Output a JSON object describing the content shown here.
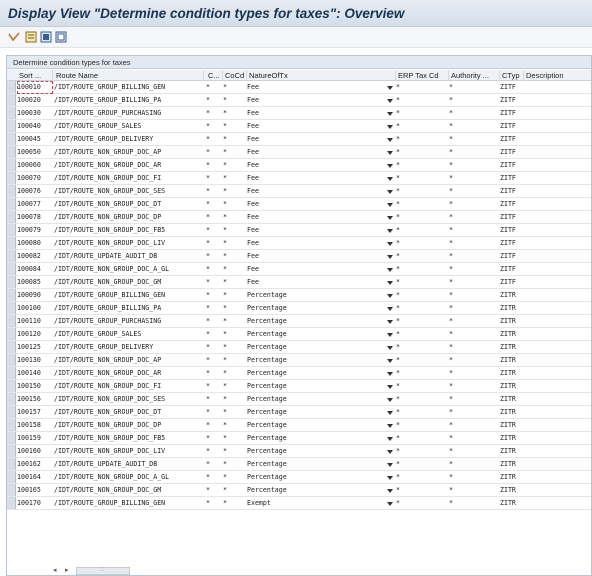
{
  "window": {
    "title": "Display View \"Determine condition types for taxes\": Overview"
  },
  "toolbar": {
    "icons": [
      "glasses-icon",
      "details-icon",
      "select-all-icon",
      "deselect-all-icon"
    ]
  },
  "table": {
    "title": "Determine condition types for taxes",
    "headers": {
      "sort": "Sort ...",
      "route": "Route Name",
      "c": "C...",
      "cocd": "CoCd",
      "nature": "NatureOfTx",
      "erp": "ERP Tax Cd",
      "authority": "Authority ...",
      "ctyp": "CTyp",
      "description": "Description"
    },
    "rows": [
      {
        "sort": "100010",
        "route": "/IDT/ROUTE_GROUP_BILLING_GEN",
        "c": "*",
        "cocd": "*",
        "nature": "Fee",
        "erp": "*",
        "authority": "*",
        "ctyp": "ZITF"
      },
      {
        "sort": "100020",
        "route": "/IDT/ROUTE_GROUP_BILLING_PA",
        "c": "*",
        "cocd": "*",
        "nature": "Fee",
        "erp": "*",
        "authority": "*",
        "ctyp": "ZITF"
      },
      {
        "sort": "100030",
        "route": "/IDT/ROUTE_GROUP_PURCHASING",
        "c": "*",
        "cocd": "*",
        "nature": "Fee",
        "erp": "*",
        "authority": "*",
        "ctyp": "ZITF"
      },
      {
        "sort": "100040",
        "route": "/IDT/ROUTE_GROUP_SALES",
        "c": "*",
        "cocd": "*",
        "nature": "Fee",
        "erp": "*",
        "authority": "*",
        "ctyp": "ZITF"
      },
      {
        "sort": "100045",
        "route": "/IDT/ROUTE_GROUP_DELIVERY",
        "c": "*",
        "cocd": "*",
        "nature": "Fee",
        "erp": "*",
        "authority": "*",
        "ctyp": "ZITF"
      },
      {
        "sort": "100050",
        "route": "/IDT/ROUTE_NON_GROUP_DOC_AP",
        "c": "*",
        "cocd": "*",
        "nature": "Fee",
        "erp": "*",
        "authority": "*",
        "ctyp": "ZITF"
      },
      {
        "sort": "100060",
        "route": "/IDT/ROUTE_NON_GROUP_DOC_AR",
        "c": "*",
        "cocd": "*",
        "nature": "Fee",
        "erp": "*",
        "authority": "*",
        "ctyp": "ZITF"
      },
      {
        "sort": "100070",
        "route": "/IDT/ROUTE_NON_GROUP_DOC_FI",
        "c": "*",
        "cocd": "*",
        "nature": "Fee",
        "erp": "*",
        "authority": "*",
        "ctyp": "ZITF"
      },
      {
        "sort": "100076",
        "route": "/IDT/ROUTE_NON_GROUP_DOC_SES",
        "c": "*",
        "cocd": "*",
        "nature": "Fee",
        "erp": "*",
        "authority": "*",
        "ctyp": "ZITF"
      },
      {
        "sort": "100077",
        "route": "/IDT/ROUTE_NON_GROUP_DOC_DT",
        "c": "*",
        "cocd": "*",
        "nature": "Fee",
        "erp": "*",
        "authority": "*",
        "ctyp": "ZITF"
      },
      {
        "sort": "100078",
        "route": "/IDT/ROUTE_NON_GROUP_DOC_DP",
        "c": "*",
        "cocd": "*",
        "nature": "Fee",
        "erp": "*",
        "authority": "*",
        "ctyp": "ZITF"
      },
      {
        "sort": "100079",
        "route": "/IDT/ROUTE_NON_GROUP_DOC_FB5",
        "c": "*",
        "cocd": "*",
        "nature": "Fee",
        "erp": "*",
        "authority": "*",
        "ctyp": "ZITF"
      },
      {
        "sort": "100080",
        "route": "/IDT/ROUTE_NON_GROUP_DOC_LIV",
        "c": "*",
        "cocd": "*",
        "nature": "Fee",
        "erp": "*",
        "authority": "*",
        "ctyp": "ZITF"
      },
      {
        "sort": "100082",
        "route": "/IDT/ROUTE_UPDATE_AUDIT_DB",
        "c": "*",
        "cocd": "*",
        "nature": "Fee",
        "erp": "*",
        "authority": "*",
        "ctyp": "ZITF"
      },
      {
        "sort": "100084",
        "route": "/IDT/ROUTE_NON_GROUP_DOC_A_GL",
        "c": "*",
        "cocd": "*",
        "nature": "Fee",
        "erp": "*",
        "authority": "*",
        "ctyp": "ZITF"
      },
      {
        "sort": "100085",
        "route": "/IDT/ROUTE_NON_GROUP_DOC_GM",
        "c": "*",
        "cocd": "*",
        "nature": "Fee",
        "erp": "*",
        "authority": "*",
        "ctyp": "ZITF"
      },
      {
        "sort": "100090",
        "route": "/IDT/ROUTE_GROUP_BILLING_GEN",
        "c": "*",
        "cocd": "*",
        "nature": "Percentage",
        "erp": "*",
        "authority": "*",
        "ctyp": "ZITR"
      },
      {
        "sort": "100100",
        "route": "/IDT/ROUTE_GROUP_BILLING_PA",
        "c": "*",
        "cocd": "*",
        "nature": "Percentage",
        "erp": "*",
        "authority": "*",
        "ctyp": "ZITR"
      },
      {
        "sort": "100110",
        "route": "/IDT/ROUTE_GROUP_PURCHASING",
        "c": "*",
        "cocd": "*",
        "nature": "Percentage",
        "erp": "*",
        "authority": "*",
        "ctyp": "ZITR"
      },
      {
        "sort": "100120",
        "route": "/IDT/ROUTE_GROUP_SALES",
        "c": "*",
        "cocd": "*",
        "nature": "Percentage",
        "erp": "*",
        "authority": "*",
        "ctyp": "ZITR"
      },
      {
        "sort": "100125",
        "route": "/IDT/ROUTE_GROUP_DELIVERY",
        "c": "*",
        "cocd": "*",
        "nature": "Percentage",
        "erp": "*",
        "authority": "*",
        "ctyp": "ZITR"
      },
      {
        "sort": "100130",
        "route": "/IDT/ROUTE_NON_GROUP_DOC_AP",
        "c": "*",
        "cocd": "*",
        "nature": "Percentage",
        "erp": "*",
        "authority": "*",
        "ctyp": "ZITR"
      },
      {
        "sort": "100140",
        "route": "/IDT/ROUTE_NON_GROUP_DOC_AR",
        "c": "*",
        "cocd": "*",
        "nature": "Percentage",
        "erp": "*",
        "authority": "*",
        "ctyp": "ZITR"
      },
      {
        "sort": "100150",
        "route": "/IDT/ROUTE_NON_GROUP_DOC_FI",
        "c": "*",
        "cocd": "*",
        "nature": "Percentage",
        "erp": "*",
        "authority": "*",
        "ctyp": "ZITR"
      },
      {
        "sort": "100156",
        "route": "/IDT/ROUTE_NON_GROUP_DOC_SES",
        "c": "*",
        "cocd": "*",
        "nature": "Percentage",
        "erp": "*",
        "authority": "*",
        "ctyp": "ZITR"
      },
      {
        "sort": "100157",
        "route": "/IDT/ROUTE_NON_GROUP_DOC_DT",
        "c": "*",
        "cocd": "*",
        "nature": "Percentage",
        "erp": "*",
        "authority": "*",
        "ctyp": "ZITR"
      },
      {
        "sort": "100158",
        "route": "/IDT/ROUTE_NON_GROUP_DOC_DP",
        "c": "*",
        "cocd": "*",
        "nature": "Percentage",
        "erp": "*",
        "authority": "*",
        "ctyp": "ZITR"
      },
      {
        "sort": "100159",
        "route": "/IDT/ROUTE_NON_GROUP_DOC_FB5",
        "c": "*",
        "cocd": "*",
        "nature": "Percentage",
        "erp": "*",
        "authority": "*",
        "ctyp": "ZITR"
      },
      {
        "sort": "100160",
        "route": "/IDT/ROUTE_NON_GROUP_DOC_LIV",
        "c": "*",
        "cocd": "*",
        "nature": "Percentage",
        "erp": "*",
        "authority": "*",
        "ctyp": "ZITR"
      },
      {
        "sort": "100162",
        "route": "/IDT/ROUTE_UPDATE_AUDIT_DB",
        "c": "*",
        "cocd": "*",
        "nature": "Percentage",
        "erp": "*",
        "authority": "*",
        "ctyp": "ZITR"
      },
      {
        "sort": "100164",
        "route": "/IDT/ROUTE_NON_GROUP_DOC_A_GL",
        "c": "*",
        "cocd": "*",
        "nature": "Percentage",
        "erp": "*",
        "authority": "*",
        "ctyp": "ZITR"
      },
      {
        "sort": "100165",
        "route": "/IDT/ROUTE_NON_GROUP_DOC_GM",
        "c": "*",
        "cocd": "*",
        "nature": "Percentage",
        "erp": "*",
        "authority": "*",
        "ctyp": "ZITR"
      },
      {
        "sort": "100170",
        "route": "/IDT/ROUTE_GROUP_BILLING_GEN",
        "c": "*",
        "cocd": "*",
        "nature": "Exempt",
        "erp": "*",
        "authority": "*",
        "ctyp": "ZITR"
      }
    ]
  },
  "scrollbar": {
    "left_arrow": "◂",
    "right_arrow": "▸",
    "grip": ":::"
  }
}
